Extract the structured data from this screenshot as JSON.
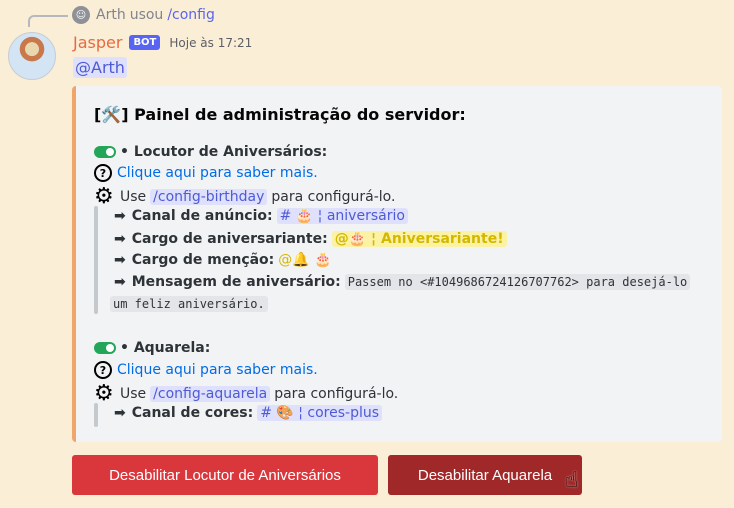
{
  "reply": {
    "user": "Arth",
    "action": "usou",
    "command": "/config"
  },
  "message": {
    "username": "Jasper",
    "bot_tag": "BOT",
    "timestamp": "Hoje às 17:21",
    "mention": "@Arth"
  },
  "embed": {
    "accent_color": "#f0a56a",
    "title": "[🛠️] Painel de administração do servidor:",
    "sections": [
      {
        "heading": "• Locutor de Aniversários:",
        "help_link": "Clique aqui para saber mais.",
        "use_prefix": "Use",
        "command": "/config-birthday",
        "use_suffix": "para configurá-lo.",
        "fields": {
          "channel_label": "Canal de anúncio:",
          "channel_value": "# 🎂 ¦ aniversário",
          "role_label": "Cargo de aniversariante:",
          "role_value": "@🎂 ¦ Aniversariante!",
          "mention_label": "Cargo de menção:",
          "mention_value": "@🔔 🎂",
          "message_label": "Mensagem de aniversário:",
          "message_value": "Passem no <#1049686724126707762> para desejá-lo",
          "message_value_cont": "um feliz aniversário."
        }
      },
      {
        "heading": "• Aquarela:",
        "help_link": "Clique aqui para saber mais.",
        "use_prefix": "Use",
        "command": "/config-aquarela",
        "use_suffix": "para configurá-lo.",
        "fields": {
          "channel_label": "Canal de cores:",
          "channel_value": "# 🎨 ¦ cores-plus"
        }
      }
    ]
  },
  "buttons": {
    "disable_birthday": "Desabilitar Locutor de Aniversários",
    "disable_aquarela": "Desabilitar Aquarela"
  },
  "arrow_glyph": "➡",
  "question_glyph": "?",
  "gear_glyph": "⚙"
}
